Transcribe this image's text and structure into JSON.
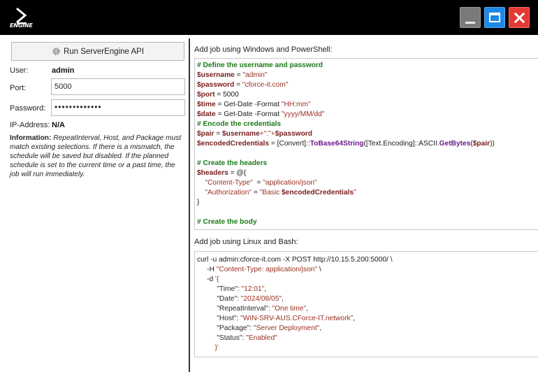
{
  "app": {
    "logo_text": "ENGINE"
  },
  "window_controls": {
    "minimize": "minimize",
    "maximize": "maximize",
    "close": "close"
  },
  "left_panel": {
    "run_button_label": "Run ServerEngine API",
    "user_label": "User:",
    "user_value": "admin",
    "port_label": "Port:",
    "port_value": "5000",
    "password_label": "Password:",
    "password_value": "•••••••••••••",
    "ip_label": "IP-Address:",
    "ip_value": "N/A",
    "info_heading": "Information:",
    "info_text": "RepeatInterval, Host, and Package must match existing selections. If there is a mismatch, the schedule will be saved but disabled. If the planned schedule is set to the current time or a past time, the job will run immediately."
  },
  "powershell": {
    "label": "Add job using Windows and PowerShell:",
    "l1": "# Define the username and password",
    "l2_var": "$username",
    "l2_eq": " = ",
    "l2_str": "\"admin\"",
    "l3_var": "$password",
    "l3_eq": " = ",
    "l3_str": "\"cforce-it.com\"",
    "l4_var": "$port",
    "l4_rest": " = 5000",
    "l5_var": "$time",
    "l5_rest": " = Get-Date -Format ",
    "l5_str": "\"HH:mm\"",
    "l6_var": "$date",
    "l6_rest": " = Get-Date -Format ",
    "l6_str": "\"yyyy/MM/dd\"",
    "l7": "# Encode the credentials",
    "l8_var": "$pair",
    "l8_eq": " = ",
    "l8_v2": "$username",
    "l8_str": "+\":\"+",
    "l8_v3": "$password",
    "l9_var": "$encodedCredentials",
    "l9_a": " = [Convert]::",
    "l9_m1": "ToBase64String",
    "l9_b": "([Text.Encoding]::ASCII.",
    "l9_m2": "GetBytes",
    "l9_c": "(",
    "l9_v": "$pair",
    "l9_d": "))",
    "l11": "# Create the headers",
    "l12_var": "$headers",
    "l12_rest": " = @{",
    "l13_str": "\"Content-Type\"",
    "l13_eq": "  = ",
    "l13_str2": "\"application/json\"",
    "l14_str": "\"Authorization\"",
    "l14_eq": " = ",
    "l14_str2": "\"Basic ",
    "l14_var": "$encodedCredentials",
    "l14_end": "\"",
    "l15": "}",
    "l17": "# Create the body"
  },
  "bash": {
    "label": "Add job using Linux and Bash:",
    "l1": "curl -u admin:cforce-it.com -X POST http://10.15.5.200:5000/ \\",
    "l2_a": "-H ",
    "l2_str": "\"Content-Type: application/json\"",
    "l2_b": " \\",
    "l3_a": "-d ",
    "l3_str": "'{",
    "l4_k": "\"Time\"",
    "l4_v": "\"12:01\"",
    "l5_k": "\"Date\"",
    "l5_v": "\"2024/08/05\"",
    "l6_k": "\"RepeatInterval\"",
    "l6_v": "\"One time\"",
    "l7_k": "\"Host\"",
    "l7_v": "\"WIN-SRV-AUS.CForce-IT.network\"",
    "l8_k": "\"Package\"",
    "l8_v": "\"Server Deployment\"",
    "l9_k": "\"Status\"",
    "l9_v": "\"Enabled\"",
    "l10": "}'"
  }
}
